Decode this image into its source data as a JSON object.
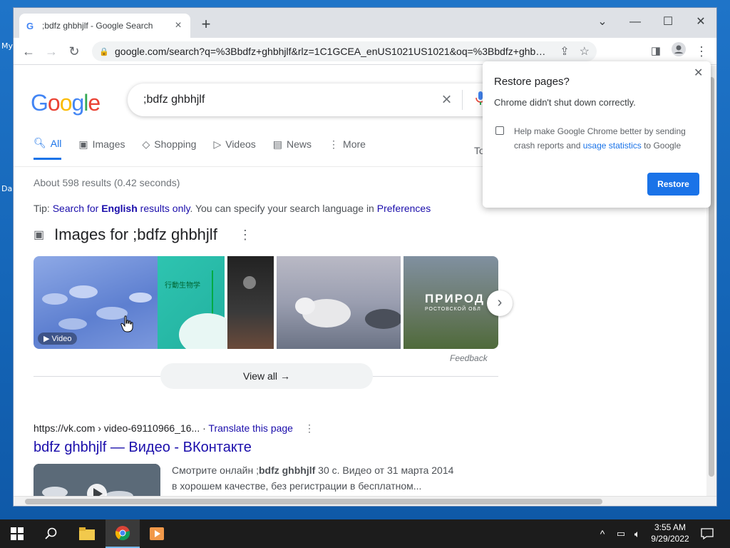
{
  "desktop": {
    "icon_label_1": "My",
    "icon_label_2": "Da"
  },
  "tab": {
    "title": ";bdfz ghbhjlf - Google Search",
    "close": "×"
  },
  "window": {
    "new_tab": "+",
    "chevron": "⌄",
    "minimize": "—",
    "maximize": "☐",
    "close": "✕"
  },
  "toolbar": {
    "url": "google.com/search?q=%3Bbdfz+ghbhjlf&rlz=1C1GCEA_enUS1021US1021&oq=%3Bbdfz+ghbhjlf&aqs=c..."
  },
  "search": {
    "logo": "Google",
    "query": ";bdfz ghbhjlf"
  },
  "nav_tabs": [
    {
      "label": "All",
      "icon": "search-icon"
    },
    {
      "label": "Images",
      "icon": "image-icon"
    },
    {
      "label": "Shopping",
      "icon": "tag-icon"
    },
    {
      "label": "Videos",
      "icon": "play-icon"
    },
    {
      "label": "News",
      "icon": "news-icon"
    },
    {
      "label": "More",
      "icon": "more-vert-icon"
    }
  ],
  "tools_label": "To",
  "stats": "About 598 results (0.42 seconds)",
  "tip": {
    "prefix": "Tip: ",
    "link_a": "Search for ",
    "english": "English",
    "link_b": " results only",
    "middle": ". You can specify your search language in ",
    "prefs": "Preferences"
  },
  "images": {
    "heading": "Images for ;bdfz ghbhjlf",
    "video_badge": "▶ Video",
    "feedback": "Feedback",
    "view_all": "View all",
    "thumb_text_1": "ПРИРОД",
    "thumb_text_2": "РОСТОВСКОЙ ОБЛ",
    "thumb_text_3": "行動生物学"
  },
  "result": {
    "breadcrumb": "https://vk.com › video-69110966_16...",
    "translate": "Translate this page",
    "title": "bdfz ghbhjlf — Видео - ВКонтакте",
    "snippet_1": "Смотрите онлайн ;",
    "snippet_bold": "bdfz ghbhjlf",
    "snippet_2": " 30 с. Видео от 31 марта 2014",
    "snippet_3": "в хорошем качестве, без регистрации в бесплатном..."
  },
  "popup": {
    "title": "Restore pages?",
    "subtitle": "Chrome didn't shut down correctly.",
    "checkbox_a": "Help make Google Chrome better by sending crash reports and ",
    "checkbox_link": "usage statistics",
    "checkbox_b": " to Google",
    "button": "Restore"
  },
  "taskbar": {
    "time": "3:55 AM",
    "date": "9/29/2022"
  },
  "colors": {
    "accent": "#1a73e8",
    "link": "#1a0dab",
    "taskbar": "#1c1c1c"
  }
}
